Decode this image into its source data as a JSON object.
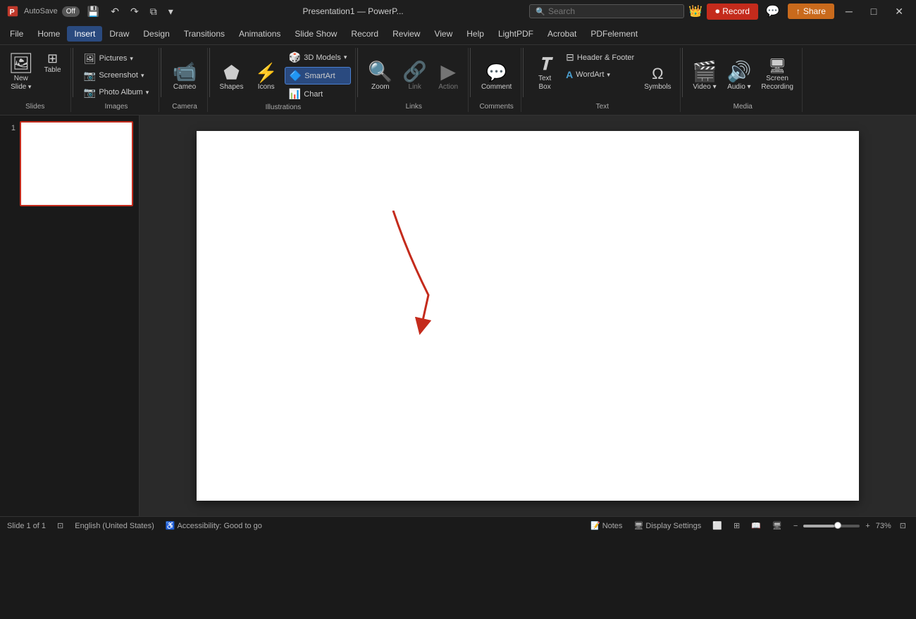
{
  "titlebar": {
    "app_name": "PowerPoint",
    "autosave_label": "AutoSave",
    "autosave_state": "Off",
    "filename": "Presentation1 — PowerP...",
    "search_placeholder": "Search",
    "record_label": "Record",
    "share_label": "Share",
    "crown_icon": "👑"
  },
  "menubar": {
    "items": [
      "File",
      "Home",
      "Insert",
      "Draw",
      "Design",
      "Transitions",
      "Animations",
      "Slide Show",
      "Record",
      "Review",
      "View",
      "Help",
      "LightPDF",
      "Acrobat",
      "PDFelement"
    ],
    "active": "Insert"
  },
  "ribbon": {
    "groups": [
      {
        "name": "Slides",
        "label": "Slides",
        "buttons": [
          {
            "id": "new-slide",
            "icon": "🖼",
            "label": "New\nSlide",
            "large": true,
            "hasArrow": true
          }
        ],
        "small_buttons": [
          {
            "id": "table",
            "icon": "⊞",
            "label": "Table"
          }
        ]
      },
      {
        "name": "Images",
        "label": "Images",
        "buttons": [
          {
            "id": "pictures",
            "icon": "🖼",
            "label": "Pictures"
          },
          {
            "id": "screenshot",
            "icon": "📷",
            "label": "Screenshot"
          },
          {
            "id": "photo-album",
            "icon": "📷",
            "label": "Photo Album"
          }
        ]
      },
      {
        "name": "Camera",
        "label": "Camera",
        "buttons": [
          {
            "id": "cameo",
            "icon": "📹",
            "label": "Cameo",
            "large": true
          }
        ]
      },
      {
        "name": "Illustrations",
        "label": "Illustrations",
        "buttons": [
          {
            "id": "shapes",
            "icon": "⬟",
            "label": "Shapes",
            "large": true
          },
          {
            "id": "icons",
            "icon": "⚡",
            "label": "Icons",
            "large": true
          },
          {
            "id": "3d-models",
            "icon": "🎲",
            "label": "3D Models"
          },
          {
            "id": "smartart",
            "icon": "🔷",
            "label": "SmartArt",
            "highlighted": true
          },
          {
            "id": "chart",
            "icon": "📊",
            "label": "Chart"
          }
        ]
      },
      {
        "name": "Links",
        "label": "Links",
        "buttons": [
          {
            "id": "zoom",
            "icon": "🔍",
            "label": "Zoom"
          },
          {
            "id": "link",
            "icon": "🔗",
            "label": "Link",
            "disabled": true
          },
          {
            "id": "action",
            "icon": "▶",
            "label": "Action",
            "disabled": true
          }
        ]
      },
      {
        "name": "Comments",
        "label": "Comments",
        "buttons": [
          {
            "id": "comment",
            "icon": "💬",
            "label": "Comment",
            "large": true
          }
        ]
      },
      {
        "name": "Text",
        "label": "Text",
        "buttons": [
          {
            "id": "text-box",
            "icon": "𝐓",
            "label": "Text\nBox",
            "large": true
          },
          {
            "id": "header-footer",
            "icon": "⊟",
            "label": "Header\n& Footer"
          },
          {
            "id": "wordart",
            "icon": "A",
            "label": "WordArt"
          },
          {
            "id": "symbols",
            "icon": "Ω",
            "label": "Symbols",
            "large": true
          }
        ]
      },
      {
        "name": "Media",
        "label": "Media",
        "buttons": [
          {
            "id": "video",
            "icon": "🎬",
            "label": "Video"
          },
          {
            "id": "audio",
            "icon": "🔊",
            "label": "Audio"
          },
          {
            "id": "screen-recording",
            "icon": "🖥",
            "label": "Screen\nRecording"
          }
        ]
      }
    ]
  },
  "slide_panel": {
    "slide_number": "1"
  },
  "statusbar": {
    "slide_info": "Slide 1 of 1",
    "language": "English (United States)",
    "accessibility": "Accessibility: Good to go",
    "notes_label": "Notes",
    "display_settings": "Display Settings",
    "zoom_level": "73%"
  },
  "colors": {
    "accent_red": "#c42b1c",
    "accent_orange": "#c96a1c",
    "active_blue": "#2a4a7f",
    "highlight_blue": "#4a7fd0"
  }
}
